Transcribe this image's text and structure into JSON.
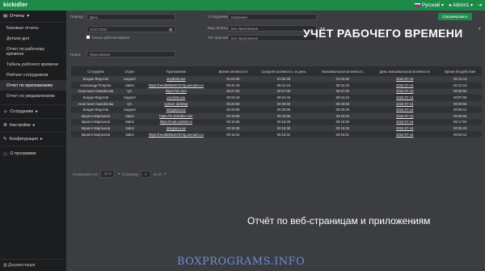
{
  "topbar": {
    "logo": "kickidler",
    "language": "Русский",
    "user": "Admin1"
  },
  "sidebar": {
    "reports_label": "Отчеты",
    "items": [
      {
        "label": "Базовые отчеты"
      },
      {
        "label": "Детали дня"
      },
      {
        "label": "Отчет по рабочему времени"
      },
      {
        "label": "Табель рабочего времени"
      },
      {
        "label": "Рейтинг сотрудников"
      },
      {
        "label": "Отчет по приложениям",
        "active": true
      },
      {
        "label": "Отчет по уведомлениям"
      }
    ],
    "groups": [
      {
        "label": "Сотрудники",
        "icon": "users-icon"
      },
      {
        "label": "Настройки",
        "icon": "gear-icon"
      },
      {
        "label": "Конфигурация",
        "icon": "wrench-icon"
      },
      {
        "label": "О программе",
        "icon": "info-icon"
      }
    ],
    "bottom_label": "Документация"
  },
  "filters": {
    "period_label": "Период",
    "period_value": "День",
    "date_value": "14.07.2022",
    "worktime_only_label": "Только рабочее время",
    "search_label": "Поиск",
    "search_placeholder": "Приложение",
    "employees_label": "Сотрудники",
    "employees_value": "Компания",
    "kind_label": "Вид оплаты",
    "kind_value": "Все приложения",
    "type_label": "Тип приложения",
    "type_value": "Все приложения",
    "generate_button": "Сформировать"
  },
  "overlay": {
    "title": "УЧЁТ РАБОЧЕГО ВРЕМЕНИ",
    "subtitle": "Отчёт по веб-страницам и приложениям"
  },
  "watermark": "BOXPROGRAMS.INFO",
  "table": {
    "headers": [
      "Сотрудник",
      "Отдел",
      "Приложение",
      "Время активности",
      "Средняя активность за день",
      "Максимальная активность",
      "День максимальной активности",
      "Время бездействия"
    ],
    "rows": [
      [
        "Богдан Федотов",
        "Support",
        "anydesk.exe",
        "01:03:28",
        "01:03:28",
        "01:03:28",
        "2022-07-14",
        "00:12:13"
      ],
      [
        "Александр Попугин",
        "Sales",
        "https://reed5085467674p.amoarm.ru",
        "00:41:19",
        "00:41:19",
        "00:41:19",
        "2022-07-14",
        "00:12:13"
      ],
      [
        "Анастасия Самойлова",
        "QA",
        "https://vk.com",
        "00:27:00",
        "00:27:00",
        "00:27:00",
        "2022-07-14",
        "00:06:55"
      ],
      [
        "Богдан Федотов",
        "Support",
        "procfest.exe",
        "00:24:43",
        "00:24:43",
        "00:24:43",
        "2022-07-14",
        "00:07:06"
      ],
      [
        "Анастасия Самойлова",
        "QA",
        "system desktop",
        "00:20:59",
        "00:20:59",
        "00:20:59",
        "2022-07-14",
        "00:09:56"
      ],
      [
        "Богдан Федотов",
        "Support",
        "telegram.exe",
        "00:20:09",
        "00:20:09",
        "00:20:09",
        "2022-07-14",
        "00:05:12"
      ],
      [
        "Кирилл Мартынов",
        "Sales",
        "https://m.kickidler.com",
        "00:16:56",
        "00:16:56",
        "00:16:56",
        "2022-07-14",
        "00:09:56"
      ],
      [
        "Кирилл Мартынов",
        "Sales",
        "https://mail.rambler.ru",
        "00:16:28",
        "00:16:28",
        "00:16:28",
        "2022-07-14",
        "00:17:53"
      ],
      [
        "Кирилл Мартынов",
        "Sales",
        "telegram.exe",
        "00:15:36",
        "00:15:36",
        "00:15:36",
        "2022-07-14",
        "00:05:29"
      ],
      [
        "Кирилл Мартынов",
        "Sales",
        "https://reed5085467674p.amoarm.ru",
        "00:15:31",
        "00:15:31",
        "00:15:31",
        "2022-07-14",
        "00:02:12"
      ]
    ]
  },
  "pager": {
    "per_page_label": "Показывать по",
    "per_page_value": "20",
    "page_label": "Страница",
    "page_value": "1",
    "of_label": "из 21"
  }
}
